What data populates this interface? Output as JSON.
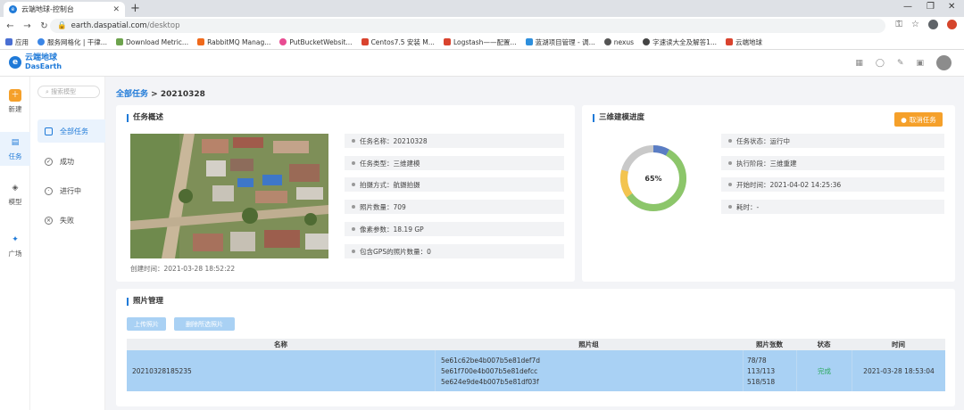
{
  "browser": {
    "tab_title": "云端地球-控制台",
    "url_host": "earth.daspatial.com",
    "url_path": "/desktop",
    "bookmarks": [
      "应用",
      "服务网格化 | 干律...",
      "Download Metric...",
      "RabbitMQ Manag...",
      "PutBucketWebsit...",
      "Centos7.5 安装 M...",
      "Logstash——配置...",
      "蓝湖项目管理 - 调...",
      "nexus",
      "字速读大全及解答1...",
      "云端地球"
    ]
  },
  "app": {
    "logo_cn": "云端地球",
    "logo_en": "DasEarth"
  },
  "rail": {
    "items": [
      "新建",
      "任务",
      "模型",
      "广场"
    ]
  },
  "submenu": {
    "search_placeholder": "搜索模型",
    "items": [
      "全部任务",
      "成功",
      "进行中",
      "失败"
    ]
  },
  "breadcrumb": {
    "root": "全部任务",
    "separator": ">",
    "current": "20210328"
  },
  "overview": {
    "title": "任务概述",
    "created": "创建时间：2021-03-28 18:52:22",
    "rows": [
      "任务名称：20210328",
      "任务类型：三维建模",
      "拍摄方式：航摄拍摄",
      "照片数量：709",
      "像素参数：18.19 GP",
      "包含GPS的照片数量：0"
    ]
  },
  "progress": {
    "title": "三维建模进度",
    "cancel_label": "取消任务",
    "percent_label": "65%",
    "percent": 65,
    "rows": [
      "任务状态：运行中",
      "执行阶段：三维重建",
      "开始时间：2021-04-02 14:25:36",
      "耗时：-"
    ],
    "colors": {
      "complete": "#8cc66a",
      "remaining": "#c9c9c9",
      "yellow": "#f3c44f",
      "blue": "#5a7dc4"
    }
  },
  "photos": {
    "title": "照片管理",
    "upload_label": "上传照片",
    "delete_label": "删除所选照片",
    "headers": [
      "名称",
      "照片组",
      "照片张数",
      "状态",
      "时间"
    ],
    "rows": [
      {
        "name": "20210328185235",
        "groups": [
          "5e61c62be4b007b5e81def7d",
          "5e61f700e4b007b5e81defcc",
          "5e624e9de4b007b5e81df03f"
        ],
        "counts": [
          "78/78",
          "113/113",
          "518/518"
        ],
        "status": "完成",
        "time": "2021-03-28 18:53:04"
      }
    ]
  },
  "colors": {
    "accent": "#1f7ad8",
    "warn": "#f5a02a"
  }
}
